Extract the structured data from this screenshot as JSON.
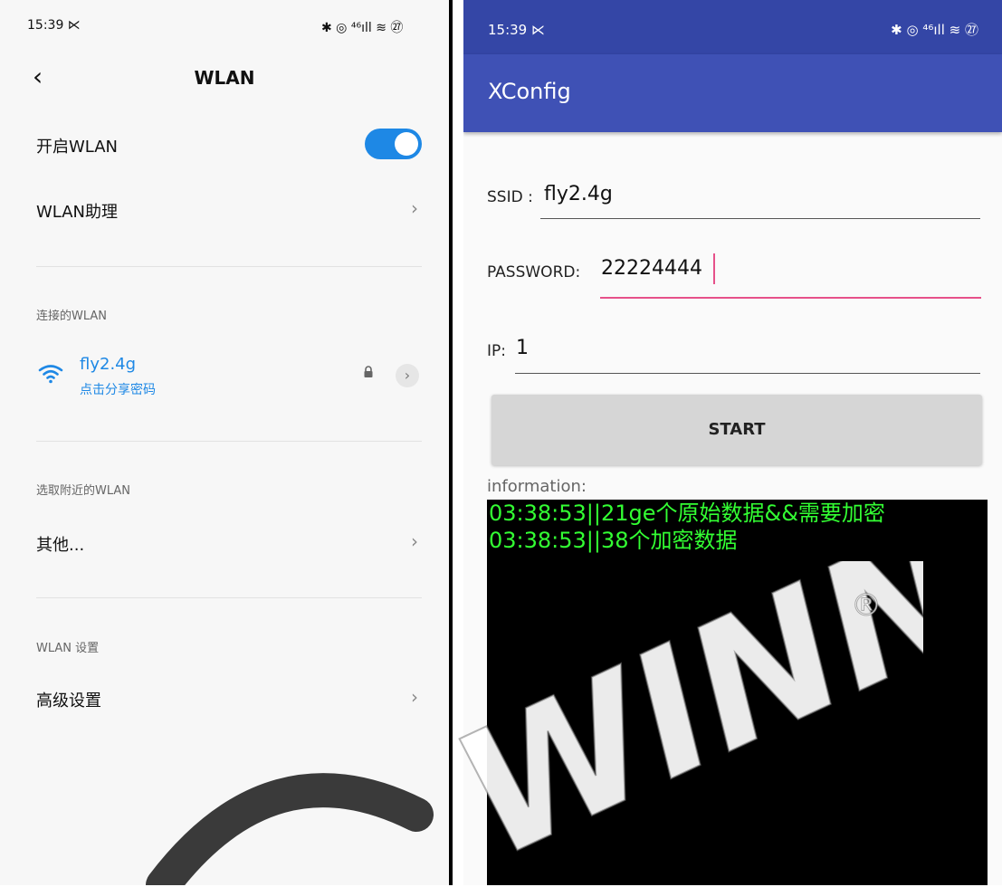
{
  "left": {
    "status": {
      "time": "15:39 ⋉",
      "icons": "✱ ◎ ⁴⁶ıll ≋ ㉗"
    },
    "title": "WLAN",
    "enable_label": "开启WLAN",
    "assistant_label": "WLAN助理",
    "connected_section": "连接的WLAN",
    "network": {
      "name": "fly2.4g",
      "sub": "点击分享密码"
    },
    "nearby_section": "选取附近的WLAN",
    "other_label": "其他...",
    "settings_section": "WLAN 设置",
    "advanced_label": "高级设置",
    "chevron": "›",
    "back": "‹",
    "toggle_on": true,
    "accent": "#1e88e5"
  },
  "right": {
    "status": {
      "time": "15:39 ⋉",
      "icons": "✱ ◎ ⁴⁶ıll ≋ ㉗"
    },
    "app_title": "XConfig",
    "ssid_label": "SSID :",
    "ssid_value": "fly2.4g",
    "password_label": "PASSWORD:",
    "password_value": "22224444",
    "ip_label": "IP:",
    "ip_value": "1",
    "start_label": "START",
    "info_label": "information:",
    "log": [
      "03:38:53||21ge个原始数据&&需要加密",
      "03:38:53||38个加密数据"
    ],
    "primary_color": "#3f51b5",
    "accent_color": "#e6518a",
    "log_color": "#33ff33"
  },
  "watermark": {
    "text": "WINNER",
    "mark": "®"
  }
}
